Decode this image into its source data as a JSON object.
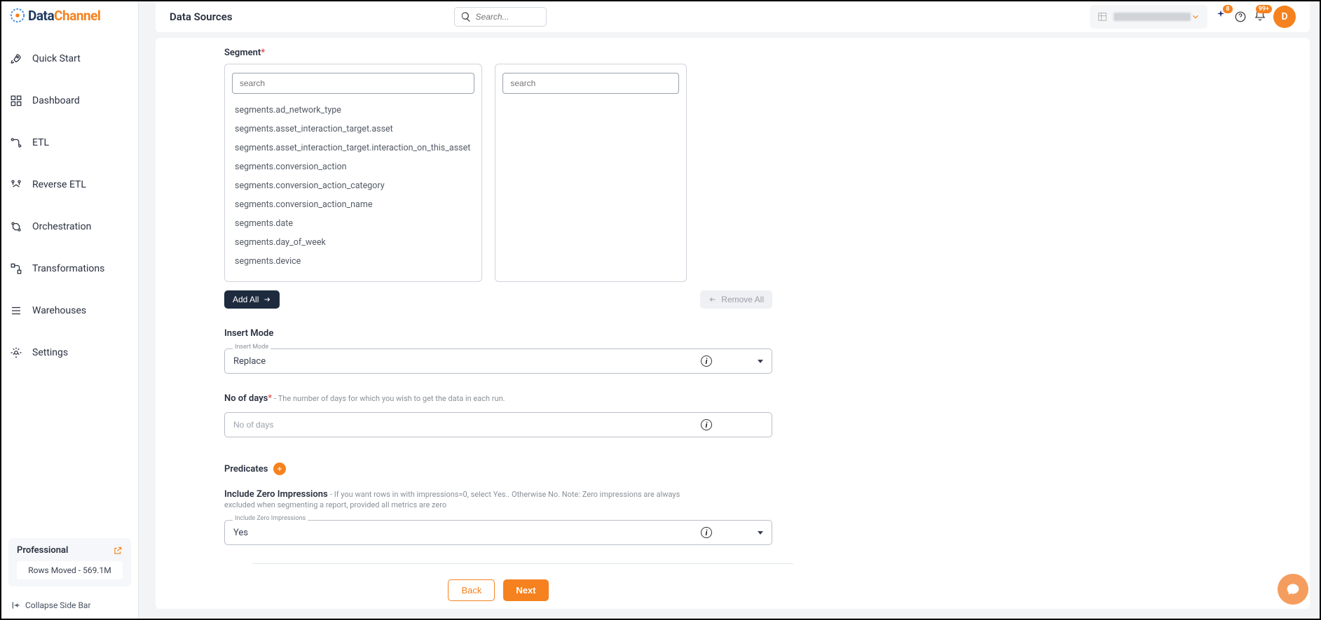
{
  "logo": {
    "part1": "Data",
    "part2": "Channel"
  },
  "sidebar": {
    "items": [
      {
        "label": "Quick Start"
      },
      {
        "label": "Dashboard"
      },
      {
        "label": "ETL"
      },
      {
        "label": "Reverse ETL"
      },
      {
        "label": "Orchestration"
      },
      {
        "label": "Transformations"
      },
      {
        "label": "Warehouses"
      },
      {
        "label": "Settings"
      }
    ],
    "plan": {
      "name": "Professional",
      "rows": "Rows Moved - 569.1M"
    },
    "collapse": "Collapse Side Bar"
  },
  "header": {
    "title": "Data Sources",
    "search_placeholder": "Search...",
    "badges": {
      "sparkle": "8",
      "bell": "99+"
    },
    "avatar": "D"
  },
  "segment": {
    "label": "Segment",
    "search_placeholder": "search",
    "available": [
      "segments.ad_network_type",
      "segments.asset_interaction_target.asset",
      "segments.asset_interaction_target.interaction_on_this_asset",
      "segments.conversion_action",
      "segments.conversion_action_category",
      "segments.conversion_action_name",
      "segments.date",
      "segments.day_of_week",
      "segments.device"
    ]
  },
  "buttons": {
    "add_all": "Add All",
    "remove_all": "Remove All"
  },
  "insert_mode": {
    "label": "Insert Mode",
    "float": "Insert Mode",
    "value": "Replace"
  },
  "no_of_days": {
    "label": "No of days",
    "help": "- The number of days for which you wish to get the data in each run.",
    "placeholder": "No of days"
  },
  "predicates": {
    "label": "Predicates"
  },
  "izi": {
    "label": "Include Zero Impressions",
    "help": "- If you want rows in with impressions=0, select Yes.. Otherwise No. Note: Zero impressions are always excluded when segmenting a report, provided all metrics are zero",
    "float": "Include Zero Impressions",
    "value": "Yes"
  },
  "info_icon": "i",
  "footer": {
    "back": "Back",
    "next": "Next"
  }
}
